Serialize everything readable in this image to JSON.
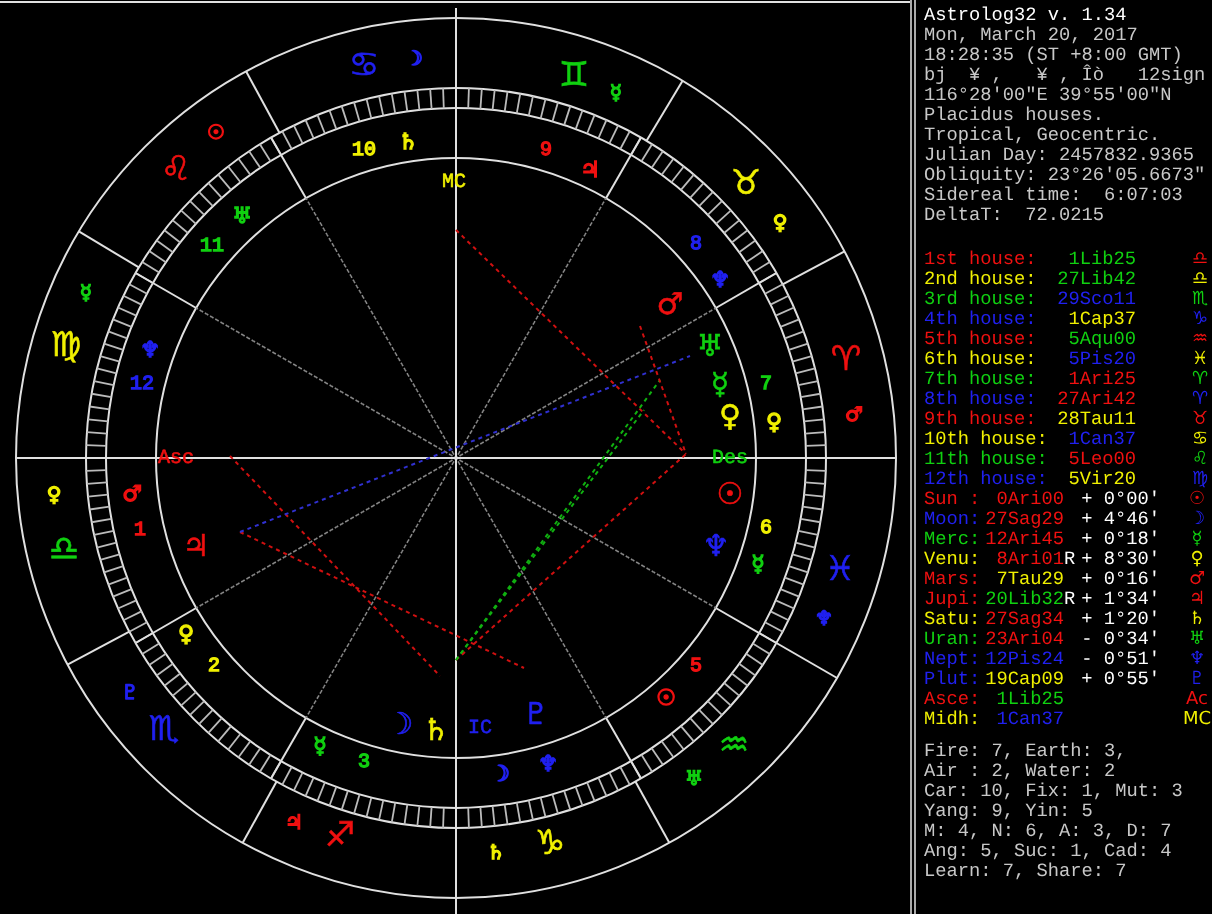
{
  "wheel": {
    "signs": [
      {
        "glyph": "♋",
        "color": "#2020f0",
        "ruler": {
          "glyph": "☽",
          "color": "#2020f0"
        }
      },
      {
        "glyph": "♊",
        "color": "#10d010",
        "ruler": {
          "glyph": "☿",
          "color": "#10d010"
        }
      },
      {
        "glyph": "♉",
        "color": "#f0f000",
        "ruler": {
          "glyph": "♀",
          "color": "#f0f000"
        }
      },
      {
        "glyph": "♈",
        "color": "#f01010",
        "ruler": {
          "glyph": "♂",
          "color": "#f01010"
        }
      },
      {
        "glyph": "♓",
        "color": "#2020f0",
        "ruler": {
          "glyph": "♆",
          "color": "#2020f0"
        }
      },
      {
        "glyph": "♒",
        "color": "#10d010",
        "ruler": {
          "glyph": "♅",
          "color": "#10d010"
        }
      },
      {
        "glyph": "♑",
        "color": "#f0f000",
        "ruler": {
          "glyph": "♄",
          "color": "#f0f000"
        }
      },
      {
        "glyph": "♐",
        "color": "#f01010",
        "ruler": {
          "glyph": "♃",
          "color": "#f01010"
        }
      },
      {
        "glyph": "♏",
        "color": "#2020f0",
        "ruler": {
          "glyph": "♇",
          "color": "#2020f0"
        }
      },
      {
        "glyph": "♎",
        "color": "#10d010",
        "ruler": {
          "glyph": "♀",
          "color": "#f0f000"
        }
      },
      {
        "glyph": "♍",
        "color": "#f0f000",
        "ruler": {
          "glyph": "☿",
          "color": "#10d010"
        }
      },
      {
        "glyph": "♌",
        "color": "#f01010",
        "ruler": {
          "glyph": "☉",
          "color": "#f01010"
        }
      }
    ],
    "houses": [
      {
        "number": "10",
        "color": "#f0f000",
        "rulers": [
          {
            "glyph": "♄",
            "color": "#f0f000"
          }
        ]
      },
      {
        "number": "9",
        "color": "#f01010",
        "rulers": [
          {
            "glyph": "♃",
            "color": "#f01010"
          }
        ]
      },
      {
        "number": "8",
        "color": "#2020f0",
        "rulers": [
          {
            "glyph": "♆",
            "color": "#2020f0"
          }
        ]
      },
      {
        "number": "7",
        "color": "#10d010",
        "rulers": [
          {
            "glyph": "♀",
            "color": "#f0f000"
          }
        ]
      },
      {
        "number": "6",
        "color": "#f0f000",
        "rulers": [
          {
            "glyph": "☿",
            "color": "#10d010"
          }
        ]
      },
      {
        "number": "5",
        "color": "#f01010",
        "rulers": [
          {
            "glyph": "☉",
            "color": "#f01010"
          }
        ]
      },
      {
        "rulers": [
          {
            "glyph": "☽",
            "color": "#2020f0"
          },
          {
            "glyph": "♆",
            "color": "#2020f0"
          }
        ]
      },
      {
        "number": "3",
        "color": "#10d010",
        "rulers": [
          {
            "glyph": "☿",
            "color": "#10d010"
          }
        ]
      },
      {
        "number": "2",
        "color": "#f0f000",
        "rulers": [
          {
            "glyph": "♀",
            "color": "#f0f000"
          }
        ]
      },
      {
        "number": "1",
        "color": "#f01010",
        "rulers": [
          {
            "glyph": "♂",
            "color": "#f01010"
          }
        ]
      },
      {
        "number": "12",
        "color": "#2020f0",
        "rulers": [
          {
            "glyph": "♆",
            "color": "#2020f0"
          }
        ]
      },
      {
        "number": "11",
        "color": "#10d010",
        "rulers": [
          {
            "glyph": "♅",
            "color": "#10d010"
          }
        ]
      }
    ],
    "planets": [
      {
        "glyph": "♂",
        "color": "#f01010"
      },
      {
        "glyph": "♅",
        "color": "#10d010"
      },
      {
        "glyph": "☿",
        "color": "#10d010"
      },
      {
        "glyph": "♀",
        "color": "#f0f000"
      },
      {
        "glyph": "☉",
        "color": "#f01010"
      },
      {
        "glyph": "♆",
        "color": "#2020f0"
      },
      {
        "glyph": "♇",
        "color": "#2020f0"
      },
      {
        "glyph": "♄",
        "color": "#f0f000"
      },
      {
        "glyph": "☽",
        "color": "#2020f0"
      },
      {
        "glyph": "♃",
        "color": "#f01010"
      }
    ],
    "angles": [
      {
        "text": "MC",
        "color": "#f0f000"
      },
      {
        "text": "Des",
        "color": "#10d010"
      },
      {
        "text": "IC",
        "color": "#2020f0"
      },
      {
        "text": "Asc",
        "color": "#f01010"
      }
    ]
  },
  "info": {
    "title": "Astrolog32 v. 1.34",
    "lines": [
      "Mon, March 20, 2017",
      "18:28:35 (ST +8:00 GMT)",
      "bj  ¥ ,   ¥ , Îò   12sign",
      "116°28'00\"E 39°55'00\"N",
      "Placidus houses.",
      "Tropical, Geocentric.",
      "Julian Day: 2457832.9365",
      "Obliquity: 23°26'05.6673\"",
      "Sidereal time:  6:07:03",
      "DeltaT:  72.0215"
    ]
  },
  "house_cusps": [
    {
      "label": {
        "text": "1st house:",
        "color": "#f01010"
      },
      "value": {
        "text": "1Lib25",
        "color": "#10d010"
      },
      "sign": {
        "glyph": "♎",
        "color": "#f01010"
      }
    },
    {
      "label": {
        "text": "2nd house:",
        "color": "#f0f000"
      },
      "value": {
        "text": "27Lib42",
        "color": "#10d010"
      },
      "sign": {
        "glyph": "♎",
        "color": "#f0f000"
      }
    },
    {
      "label": {
        "text": "3rd house:",
        "color": "#10d010"
      },
      "value": {
        "text": "29Sco11",
        "color": "#2020f0"
      },
      "sign": {
        "glyph": "♏",
        "color": "#10d010"
      }
    },
    {
      "label": {
        "text": "4th house:",
        "color": "#2020f0"
      },
      "value": {
        "text": "1Cap37",
        "color": "#f0f000"
      },
      "sign": {
        "glyph": "♑",
        "color": "#2020f0"
      }
    },
    {
      "label": {
        "text": "5th house:",
        "color": "#f01010"
      },
      "value": {
        "text": "5Aqu00",
        "color": "#10d010"
      },
      "sign": {
        "glyph": "♒",
        "color": "#f01010"
      }
    },
    {
      "label": {
        "text": "6th house:",
        "color": "#f0f000"
      },
      "value": {
        "text": "5Pis20",
        "color": "#2020f0"
      },
      "sign": {
        "glyph": "♓",
        "color": "#f0f000"
      }
    },
    {
      "label": {
        "text": "7th house:",
        "color": "#10d010"
      },
      "value": {
        "text": "1Ari25",
        "color": "#f01010"
      },
      "sign": {
        "glyph": "♈",
        "color": "#10d010"
      }
    },
    {
      "label": {
        "text": "8th house:",
        "color": "#2020f0"
      },
      "value": {
        "text": "27Ari42",
        "color": "#f01010"
      },
      "sign": {
        "glyph": "♈",
        "color": "#2020f0"
      }
    },
    {
      "label": {
        "text": "9th house:",
        "color": "#f01010"
      },
      "value": {
        "text": "28Tau11",
        "color": "#f0f000"
      },
      "sign": {
        "glyph": "♉",
        "color": "#f01010"
      }
    },
    {
      "label": {
        "text": "10th house:",
        "color": "#f0f000"
      },
      "value": {
        "text": "1Can37",
        "color": "#2020f0"
      },
      "sign": {
        "glyph": "♋",
        "color": "#f0f000"
      }
    },
    {
      "label": {
        "text": "11th house:",
        "color": "#10d010"
      },
      "value": {
        "text": "5Leo00",
        "color": "#f01010"
      },
      "sign": {
        "glyph": "♌",
        "color": "#10d010"
      }
    },
    {
      "label": {
        "text": "12th house:",
        "color": "#2020f0"
      },
      "value": {
        "text": "5Vir20",
        "color": "#f0f000"
      },
      "sign": {
        "glyph": "♍",
        "color": "#2020f0"
      }
    }
  ],
  "positions": [
    {
      "label": {
        "text": "Sun :",
        "color": "#f01010"
      },
      "value": {
        "text": "0Ari00",
        "color": "#f01010"
      },
      "motion": "+ 0°00'",
      "glyph": "☉"
    },
    {
      "label": {
        "text": "Moon:",
        "color": "#2020f0"
      },
      "value": {
        "text": "27Sag29",
        "color": "#f01010"
      },
      "motion": "+ 4°46'",
      "glyph": "☽"
    },
    {
      "label": {
        "text": "Merc:",
        "color": "#10d010"
      },
      "value": {
        "text": "12Ari45",
        "color": "#f01010"
      },
      "motion": "+ 0°18'",
      "glyph": "☿"
    },
    {
      "label": {
        "text": "Venu:",
        "color": "#f0f000"
      },
      "value": {
        "text": "8Ari01",
        "color": "#f01010"
      },
      "flag": "R",
      "motion": "+ 8°30'",
      "glyph": "♀"
    },
    {
      "label": {
        "text": "Mars:",
        "color": "#f01010"
      },
      "value": {
        "text": "7Tau29",
        "color": "#f0f000"
      },
      "motion": "+ 0°16'",
      "glyph": "♂"
    },
    {
      "label": {
        "text": "Jupi:",
        "color": "#f01010"
      },
      "value": {
        "text": "20Lib32",
        "color": "#10d010"
      },
      "flag": "R",
      "motion": "+ 1°34'",
      "glyph": "♃"
    },
    {
      "label": {
        "text": "Satu:",
        "color": "#f0f000"
      },
      "value": {
        "text": "27Sag34",
        "color": "#f01010"
      },
      "motion": "+ 1°20'",
      "glyph": "♄"
    },
    {
      "label": {
        "text": "Uran:",
        "color": "#10d010"
      },
      "value": {
        "text": "23Ari04",
        "color": "#f01010"
      },
      "motion": "- 0°34'",
      "glyph": "♅"
    },
    {
      "label": {
        "text": "Nept:",
        "color": "#2020f0"
      },
      "value": {
        "text": "12Pis24",
        "color": "#2020f0"
      },
      "motion": "- 0°51'",
      "glyph": "♆"
    },
    {
      "label": {
        "text": "Plut:",
        "color": "#2020f0"
      },
      "value": {
        "text": "19Cap09",
        "color": "#f0f000"
      },
      "motion": "+ 0°55'",
      "glyph": "♇"
    },
    {
      "label": {
        "text": "Asce:",
        "color": "#f01010"
      },
      "value": {
        "text": "1Lib25",
        "color": "#10d010"
      },
      "glyph": "Ac"
    },
    {
      "label": {
        "text": "Midh:",
        "color": "#f0f000"
      },
      "value": {
        "text": "1Can37",
        "color": "#2020f0"
      },
      "glyph": "MC"
    }
  ],
  "summary": [
    "Fire: 7, Earth: 3,",
    "Air : 2, Water: 2",
    "Car: 10, Fix: 1, Mut: 3",
    "Yang: 9, Yin: 5",
    "M: 4, N: 6, A: 3, D: 7",
    "Ang: 5, Suc: 1, Cad: 4",
    "Learn: 7, Share: 7"
  ]
}
